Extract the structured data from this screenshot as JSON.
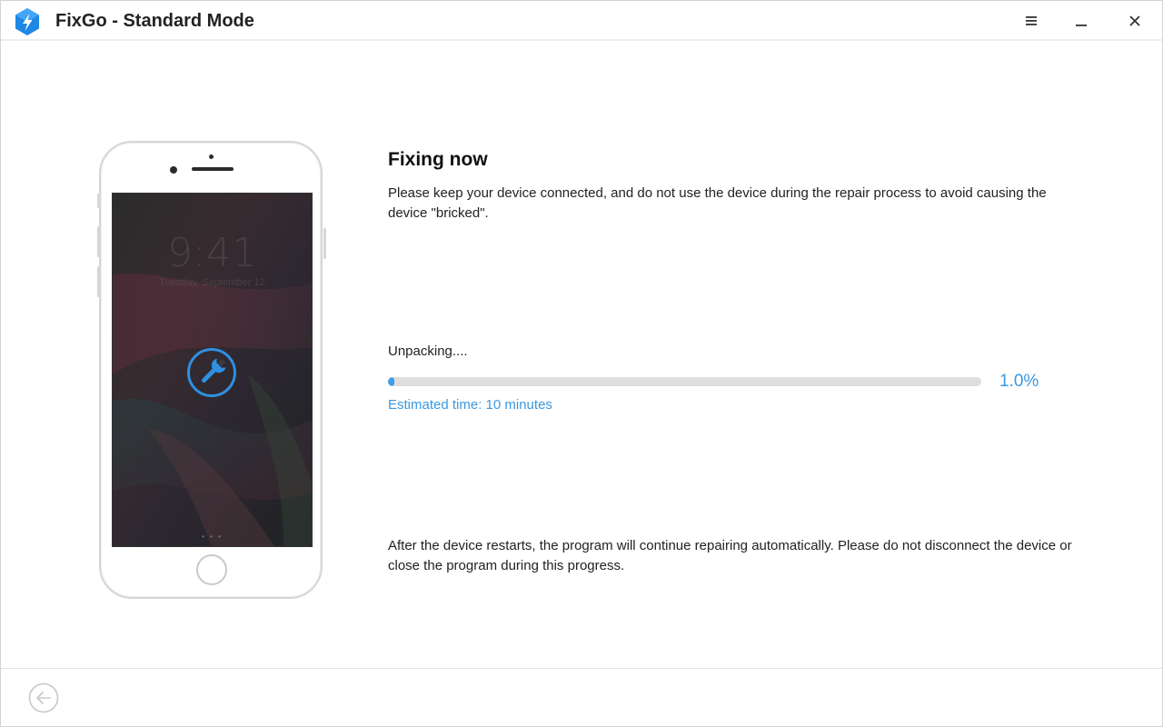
{
  "window": {
    "title": "FixGo - Standard Mode",
    "logo_icon": "fixgo-logo-icon",
    "controls": [
      "menu-icon",
      "minimize-icon",
      "close-icon"
    ]
  },
  "device": {
    "lock_time": "9:41",
    "lock_date": "Tuesday, September 12",
    "overlay_icon": "wrench-icon",
    "page_dots": "• • •"
  },
  "main": {
    "heading": "Fixing now",
    "description": "Please keep your device connected, and do not use the device during the repair process to avoid causing the device \"bricked\".",
    "status_text": "Unpacking....",
    "progress_percent": 1.0,
    "progress_label": "1.0%",
    "estimated_time": "Estimated time: 10 minutes",
    "footnote": "After the device restarts, the program will continue repairing automatically. Please do not disconnect the device or close the program during this progress."
  },
  "footer": {
    "back_icon": "back-arrow-icon"
  },
  "colors": {
    "accent": "#3b98e0",
    "progress_track": "#dedede",
    "logo_blue": "#1e88e5"
  }
}
